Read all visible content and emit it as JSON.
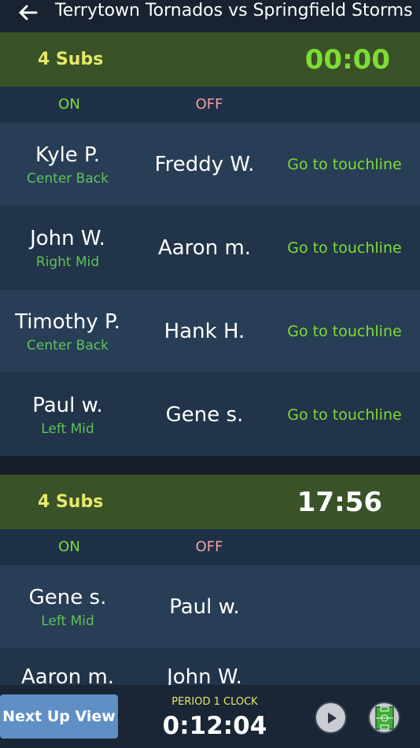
{
  "header": {
    "title": "Terrytown Tornados vs Springfield Storms"
  },
  "groups": [
    {
      "subs_label": "4 Subs",
      "clock": "00:00",
      "on_label": "ON",
      "off_label": "OFF",
      "rows": [
        {
          "on_name": "Kyle P.",
          "on_position": "Center Back",
          "off_name": "Freddy W.",
          "action": "Go to touchline"
        },
        {
          "on_name": "John W.",
          "on_position": "Right Mid",
          "off_name": "Aaron m.",
          "action": "Go to touchline"
        },
        {
          "on_name": "Timothy P.",
          "on_position": "Center Back",
          "off_name": "Hank H.",
          "action": "Go to touchline"
        },
        {
          "on_name": "Paul w.",
          "on_position": "Left Mid",
          "off_name": "Gene s.",
          "action": "Go to touchline"
        }
      ]
    },
    {
      "subs_label": "4 Subs",
      "clock": "17:56",
      "on_label": "ON",
      "off_label": "OFF",
      "rows": [
        {
          "on_name": "Gene s.",
          "on_position": "Left Mid",
          "off_name": "Paul w."
        },
        {
          "on_name": "Aaron m.",
          "off_name": "John W."
        }
      ]
    }
  ],
  "footer": {
    "next_up_label": "Next Up View",
    "period_label": "PERIOD 1 CLOCK",
    "period_time": "0:12:04",
    "play_icon": "play-icon",
    "field_icon": "soccer-field-icon"
  },
  "colors": {
    "accent_green": "#7ddc36",
    "subs_yellow": "#e6e86a",
    "off_pink": "#f0a0a0",
    "header_green": "#3a5228",
    "button_blue": "#5f8fc4"
  }
}
